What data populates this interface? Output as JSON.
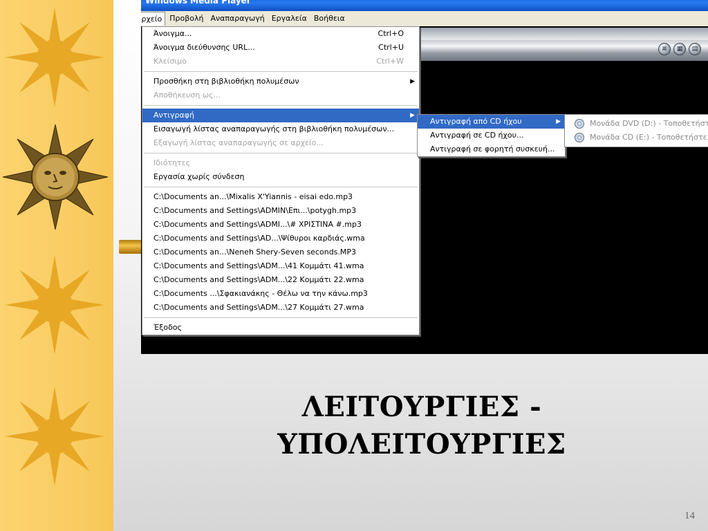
{
  "window": {
    "title": "Windows Media Player"
  },
  "menubar": [
    {
      "label": "Αρχείο",
      "active": true
    },
    {
      "label": "Προβολή",
      "active": false
    },
    {
      "label": "Αναπαραγωγή",
      "active": false
    },
    {
      "label": "Εργαλεία",
      "active": false
    },
    {
      "label": "Βοήθεια",
      "active": false
    }
  ],
  "file_menu": {
    "open": {
      "label": "Άνοιγμα...",
      "shortcut": "Ctrl+O"
    },
    "open_url": {
      "label": "Άνοιγμα διεύθυνσης URL...",
      "shortcut": "Ctrl+U"
    },
    "close": {
      "label": "Κλείσιμο",
      "shortcut": "Ctrl+W",
      "disabled": true
    },
    "add_to_library": {
      "label": "Προσθήκη στη βιβλιοθήκη πολυμέσων"
    },
    "save_as": {
      "label": "Αποθήκευση ως...",
      "disabled": true
    },
    "copy": {
      "label": "Αντιγραφή"
    },
    "import_playlist": {
      "label": "Εισαγωγή λίστας αναπαραγωγής στη βιβλιοθήκη πολυμέσων..."
    },
    "export_playlist": {
      "label": "Εξαγωγή λίστας αναπαραγωγής σε αρχείο...",
      "disabled": true
    },
    "properties": {
      "label": "Ιδιότητες",
      "disabled": true
    },
    "work_offline": {
      "label": "Εργασία χωρίς σύνδεση"
    },
    "recent": [
      "C:\\Documents an...\\Mixalis X'Yiannis - eisai edo.mp3",
      "C:\\Documents and Settings\\ADMIN\\Επι...\\potygh.mp3",
      "C:\\Documents and Settings\\ADMI...\\# ΧΡΙΣΤΙΝΑ #.mp3",
      "C:\\Documents and Settings\\AD...\\Ψίθυροι καρδιάς.wma",
      "C:\\Documents an...\\Neneh Shery-Seven seconds.MP3",
      "C:\\Documents and Settings\\ADM...\\41 Κομμάτι 41.wma",
      "C:\\Documents and Settings\\ADM...\\22 Κομμάτι 22.wma",
      "C:\\Documents ...\\Σφακιανάκης - Θέλω να την κάνω.mp3",
      "C:\\Documents and Settings\\ADM...\\27 Κομμάτι 27.wma"
    ],
    "exit": {
      "label": "Έξοδος"
    }
  },
  "copy_submenu": {
    "copy_from_cd": "Αντιγραφή από CD ήχου",
    "copy_to_cd": "Αντιγραφή σε CD ήχου...",
    "copy_to_device": "Αντιγραφή σε φορητή συσκευή..."
  },
  "drive_submenu": {
    "dvd": "Μονάδα DVD (D:) - Τοποθετήστε δ",
    "cd": "Μονάδα CD (E:) - Τοποθετήστε δί"
  },
  "slide": {
    "title_line1": "ΛΕΙΤΟΥΡΓΙΕΣ -",
    "title_line2": "ΥΠΟΛΕΙΤΟΥΡΓΙΕΣ",
    "page_number": "14"
  },
  "colors": {
    "left_band": "#fbd06a",
    "menu_highlight": "#316ac5",
    "title_bar": "#0a5fd8"
  }
}
